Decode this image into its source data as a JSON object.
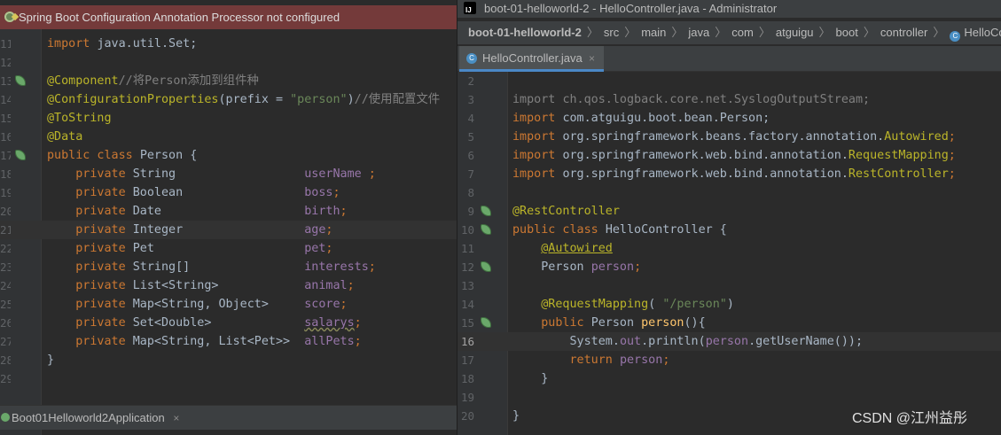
{
  "left_pane": {
    "warning_text": "Spring Boot Configuration Annotation Processor not configured",
    "lines": [
      {
        "num": "11",
        "parts": [
          {
            "t": "import ",
            "c": "kw"
          },
          {
            "t": "java.util.Set;",
            "c": "plain"
          }
        ]
      },
      {
        "num": "12",
        "parts": []
      },
      {
        "num": "13",
        "icon": "bean-icon",
        "parts": [
          {
            "t": "@Component",
            "c": "ann"
          },
          {
            "t": "//将Person添加到组件种",
            "c": "cmt"
          }
        ]
      },
      {
        "num": "14",
        "parts": [
          {
            "t": "@ConfigurationProperties",
            "c": "ann"
          },
          {
            "t": "(prefix = ",
            "c": "plain"
          },
          {
            "t": "\"person\"",
            "c": "str"
          },
          {
            "t": ")",
            "c": "plain"
          },
          {
            "t": "//使用配置文件",
            "c": "cmt"
          }
        ]
      },
      {
        "num": "15",
        "parts": [
          {
            "t": "@ToString",
            "c": "ann"
          }
        ]
      },
      {
        "num": "16",
        "parts": [
          {
            "t": "@Data",
            "c": "ann"
          }
        ]
      },
      {
        "num": "17",
        "icon": "bean-icon",
        "parts": [
          {
            "t": "public class ",
            "c": "kw"
          },
          {
            "t": "Person {",
            "c": "plain"
          }
        ]
      },
      {
        "num": "18",
        "parts": [
          {
            "t": "    private ",
            "c": "kw"
          },
          {
            "t": "String                  ",
            "c": "plain"
          },
          {
            "t": "userName ",
            "c": "fld"
          },
          {
            "t": ";",
            "c": "kw"
          }
        ]
      },
      {
        "num": "19",
        "parts": [
          {
            "t": "    private ",
            "c": "kw"
          },
          {
            "t": "Boolean                 ",
            "c": "plain"
          },
          {
            "t": "boss",
            "c": "fld"
          },
          {
            "t": ";",
            "c": "kw"
          }
        ]
      },
      {
        "num": "20",
        "parts": [
          {
            "t": "    private ",
            "c": "kw"
          },
          {
            "t": "Date                    ",
            "c": "plain"
          },
          {
            "t": "birth",
            "c": "fld"
          },
          {
            "t": ";",
            "c": "kw"
          }
        ]
      },
      {
        "num": "21",
        "hl": true,
        "parts": [
          {
            "t": "    private ",
            "c": "kw"
          },
          {
            "t": "Integer                 ",
            "c": "plain"
          },
          {
            "t": "age",
            "c": "fld"
          },
          {
            "t": ";",
            "c": "kw"
          }
        ]
      },
      {
        "num": "22",
        "parts": [
          {
            "t": "    private ",
            "c": "kw"
          },
          {
            "t": "Pet                     ",
            "c": "plain"
          },
          {
            "t": "pet",
            "c": "fld"
          },
          {
            "t": ";",
            "c": "kw"
          }
        ]
      },
      {
        "num": "23",
        "parts": [
          {
            "t": "    private ",
            "c": "kw"
          },
          {
            "t": "String[]                ",
            "c": "plain"
          },
          {
            "t": "interests",
            "c": "fld"
          },
          {
            "t": ";",
            "c": "kw"
          }
        ]
      },
      {
        "num": "24",
        "parts": [
          {
            "t": "    private ",
            "c": "kw"
          },
          {
            "t": "List<String>            ",
            "c": "plain"
          },
          {
            "t": "animal",
            "c": "fld"
          },
          {
            "t": ";",
            "c": "kw"
          }
        ]
      },
      {
        "num": "25",
        "parts": [
          {
            "t": "    private ",
            "c": "kw"
          },
          {
            "t": "Map<String, Object>     ",
            "c": "plain"
          },
          {
            "t": "score",
            "c": "fld"
          },
          {
            "t": ";",
            "c": "kw"
          }
        ]
      },
      {
        "num": "26",
        "parts": [
          {
            "t": "    private ",
            "c": "kw"
          },
          {
            "t": "Set<Double>             ",
            "c": "plain"
          },
          {
            "t": "salarys",
            "c": "fld-warn"
          },
          {
            "t": ";",
            "c": "kw"
          }
        ]
      },
      {
        "num": "27",
        "parts": [
          {
            "t": "    private ",
            "c": "kw"
          },
          {
            "t": "Map<String, List<Pet>>  ",
            "c": "plain"
          },
          {
            "t": "allPets",
            "c": "fld"
          },
          {
            "t": ";",
            "c": "kw"
          }
        ]
      },
      {
        "num": "28",
        "parts": [
          {
            "t": "}",
            "c": "plain"
          }
        ]
      },
      {
        "num": "29",
        "parts": []
      }
    ],
    "run_tab": {
      "label": "Boot01Helloworld2Application",
      "close": "×"
    }
  },
  "right_pane": {
    "window_title": "boot-01-helloworld-2 - HelloController.java - Administrator",
    "breadcrumb": [
      "boot-01-helloworld-2",
      "src",
      "main",
      "java",
      "com",
      "atguigu",
      "boot",
      "controller",
      "HelloController"
    ],
    "breadcrumb_sep": "〉",
    "tab": {
      "label": "HelloController.java",
      "close": "×",
      "icon_letter": "C"
    },
    "lines": [
      {
        "num": "2",
        "parts": []
      },
      {
        "num": "3",
        "parts": [
          {
            "t": "import ",
            "c": "cmt"
          },
          {
            "t": "ch.qos.logback.core.net.SyslogOutputStream;",
            "c": "cmt"
          }
        ]
      },
      {
        "num": "4",
        "parts": [
          {
            "t": "import ",
            "c": "kw"
          },
          {
            "t": "com.atguigu.boot.bean.Person;",
            "c": "plain"
          }
        ]
      },
      {
        "num": "5",
        "parts": [
          {
            "t": "import ",
            "c": "kw"
          },
          {
            "t": "org.springframework.beans.factory.annotation.",
            "c": "plain"
          },
          {
            "t": "Autowired",
            "c": "ann"
          },
          {
            "t": ";",
            "c": "kw"
          }
        ]
      },
      {
        "num": "6",
        "parts": [
          {
            "t": "import ",
            "c": "kw"
          },
          {
            "t": "org.springframework.web.bind.annotation.",
            "c": "plain"
          },
          {
            "t": "RequestMapping",
            "c": "ann"
          },
          {
            "t": ";",
            "c": "kw"
          }
        ]
      },
      {
        "num": "7",
        "parts": [
          {
            "t": "import ",
            "c": "kw"
          },
          {
            "t": "org.springframework.web.bind.annotation.",
            "c": "plain"
          },
          {
            "t": "RestController",
            "c": "ann"
          },
          {
            "t": ";",
            "c": "kw"
          }
        ]
      },
      {
        "num": "8",
        "parts": []
      },
      {
        "num": "9",
        "icon": "bean-icon",
        "parts": [
          {
            "t": "@RestController",
            "c": "ann"
          }
        ]
      },
      {
        "num": "10",
        "icon": "bean-icon",
        "parts": [
          {
            "t": "public class ",
            "c": "kw"
          },
          {
            "t": "HelloController {",
            "c": "plain"
          }
        ]
      },
      {
        "num": "11",
        "parts": [
          {
            "t": "    ",
            "c": "plain"
          },
          {
            "t": "@Autowired",
            "c": "ann-hl"
          }
        ]
      },
      {
        "num": "12",
        "icon": "bean-icon",
        "parts": [
          {
            "t": "    Person ",
            "c": "plain"
          },
          {
            "t": "person",
            "c": "fld"
          },
          {
            "t": ";",
            "c": "kw"
          }
        ]
      },
      {
        "num": "13",
        "parts": []
      },
      {
        "num": "14",
        "parts": [
          {
            "t": "    ",
            "c": "plain"
          },
          {
            "t": "@RequestMapping",
            "c": "ann"
          },
          {
            "t": "( ",
            "c": "plain"
          },
          {
            "t": "\"/person\"",
            "c": "str"
          },
          {
            "t": ")",
            "c": "plain"
          }
        ]
      },
      {
        "num": "15",
        "icon": "bean-icon",
        "parts": [
          {
            "t": "    ",
            "c": "plain"
          },
          {
            "t": "public ",
            "c": "kw"
          },
          {
            "t": "Person ",
            "c": "plain"
          },
          {
            "t": "person",
            "c": "fn"
          },
          {
            "t": "(){",
            "c": "plain"
          }
        ]
      },
      {
        "num": "16",
        "hl": true,
        "cur": true,
        "parts": [
          {
            "t": "        System.",
            "c": "plain"
          },
          {
            "t": "out",
            "c": "fld"
          },
          {
            "t": ".println(",
            "c": "plain"
          },
          {
            "t": "person",
            "c": "fld"
          },
          {
            "t": ".getUserName());",
            "c": "plain"
          }
        ]
      },
      {
        "num": "17",
        "parts": [
          {
            "t": "        ",
            "c": "plain"
          },
          {
            "t": "return ",
            "c": "kw"
          },
          {
            "t": "person",
            "c": "fld"
          },
          {
            "t": ";",
            "c": "kw"
          }
        ]
      },
      {
        "num": "18",
        "parts": [
          {
            "t": "    }",
            "c": "plain"
          }
        ]
      },
      {
        "num": "19",
        "parts": []
      },
      {
        "num": "20",
        "parts": [
          {
            "t": "}",
            "c": "plain"
          }
        ]
      }
    ]
  },
  "watermark": "CSDN @江州益彤",
  "colors": {
    "keyword": "#cc7832",
    "annotation": "#bbb529",
    "comment": "#808080",
    "string": "#6a8759",
    "field": "#9876aa",
    "plain": "#a9b7c6",
    "warning_bg": "#743a3a"
  }
}
